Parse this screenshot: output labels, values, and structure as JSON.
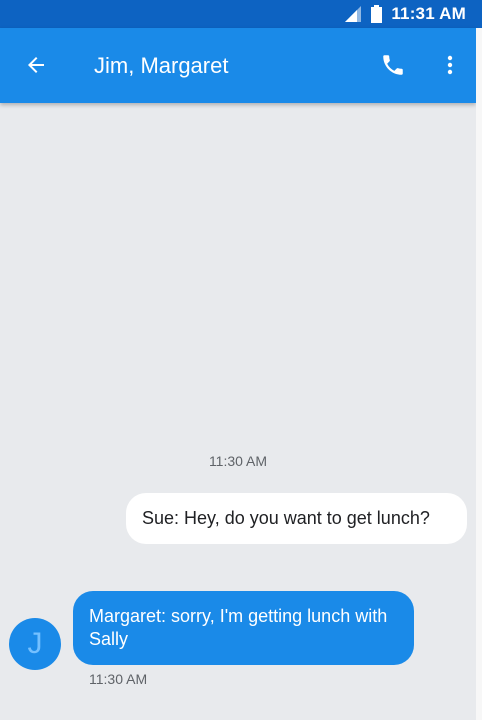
{
  "status_bar": {
    "time": "11:31 AM"
  },
  "app_bar": {
    "title": "Jim, Margaret",
    "back_icon": "arrow-back-icon",
    "call_icon": "phone-icon",
    "more_icon": "more-vert-icon"
  },
  "conversation": {
    "divider_time": "11:30 AM",
    "messages": [
      {
        "direction": "outgoing",
        "text": "Sue: Hey, do you want to get lunch?"
      },
      {
        "direction": "incoming",
        "text": "Margaret: sorry, I'm getting lunch with Sally",
        "avatar_letter": "J",
        "time": "11:30 AM"
      }
    ]
  },
  "colors": {
    "status_bar": "#0d63c2",
    "app_bar": "#1a8ae8",
    "background": "#e8eaed",
    "outgoing_bubble": "#ffffff",
    "incoming_bubble": "#1a8ae8"
  }
}
